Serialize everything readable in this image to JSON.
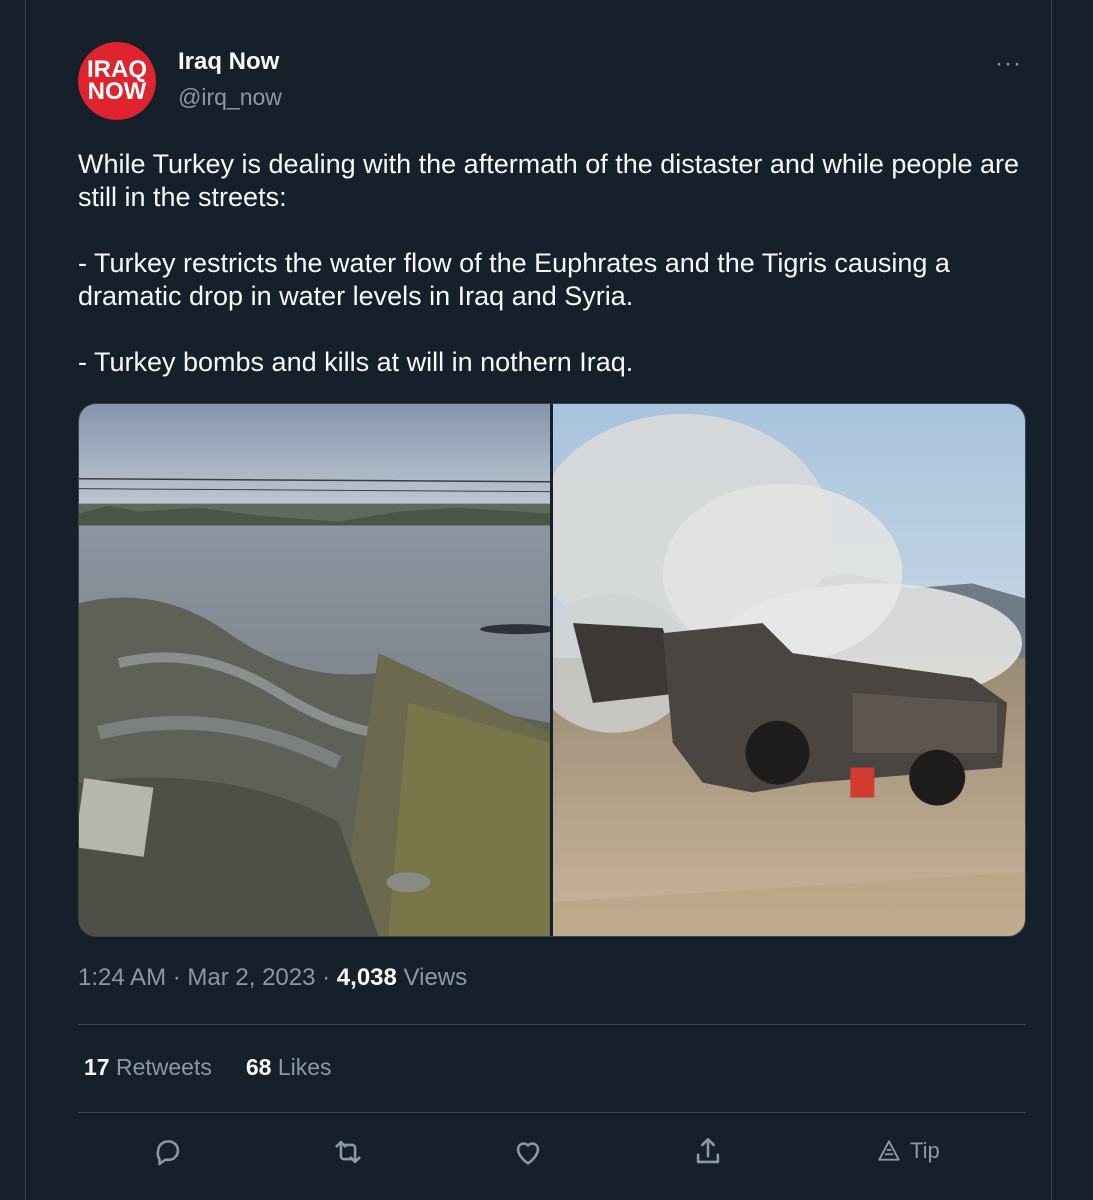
{
  "author": {
    "name": "Iraq Now",
    "handle": "@irq_now",
    "avatar_text_line1": "IRAQ",
    "avatar_text_line2": "NOW"
  },
  "more_label": "···",
  "tweet": {
    "paragraphs": [
      "While Turkey is dealing with the aftermath of the distaster and while people are still in the streets:",
      "- Turkey restricts the water flow of the Euphrates and the Tigris causing a dramatic drop in water levels in Iraq and Syria.",
      "- Turkey bombs and kills at will in nothern Iraq."
    ]
  },
  "meta": {
    "time": "1:24 AM",
    "separator": " · ",
    "date": "Mar 2, 2023",
    "views_count": "4,038",
    "views_label": "Views"
  },
  "stats": {
    "retweets_count": "17",
    "retweets_label": "Retweets",
    "likes_count": "68",
    "likes_label": "Likes"
  },
  "actions": {
    "tip_label": "Tip"
  },
  "colors": {
    "background": "#15202b",
    "text": "#f7f9f9",
    "secondary": "#8b98a5",
    "border": "#38444d",
    "avatar_red": "#e0242f"
  },
  "icons": [
    "reply-icon",
    "retweet-icon",
    "like-icon",
    "share-icon",
    "tip-icon"
  ]
}
